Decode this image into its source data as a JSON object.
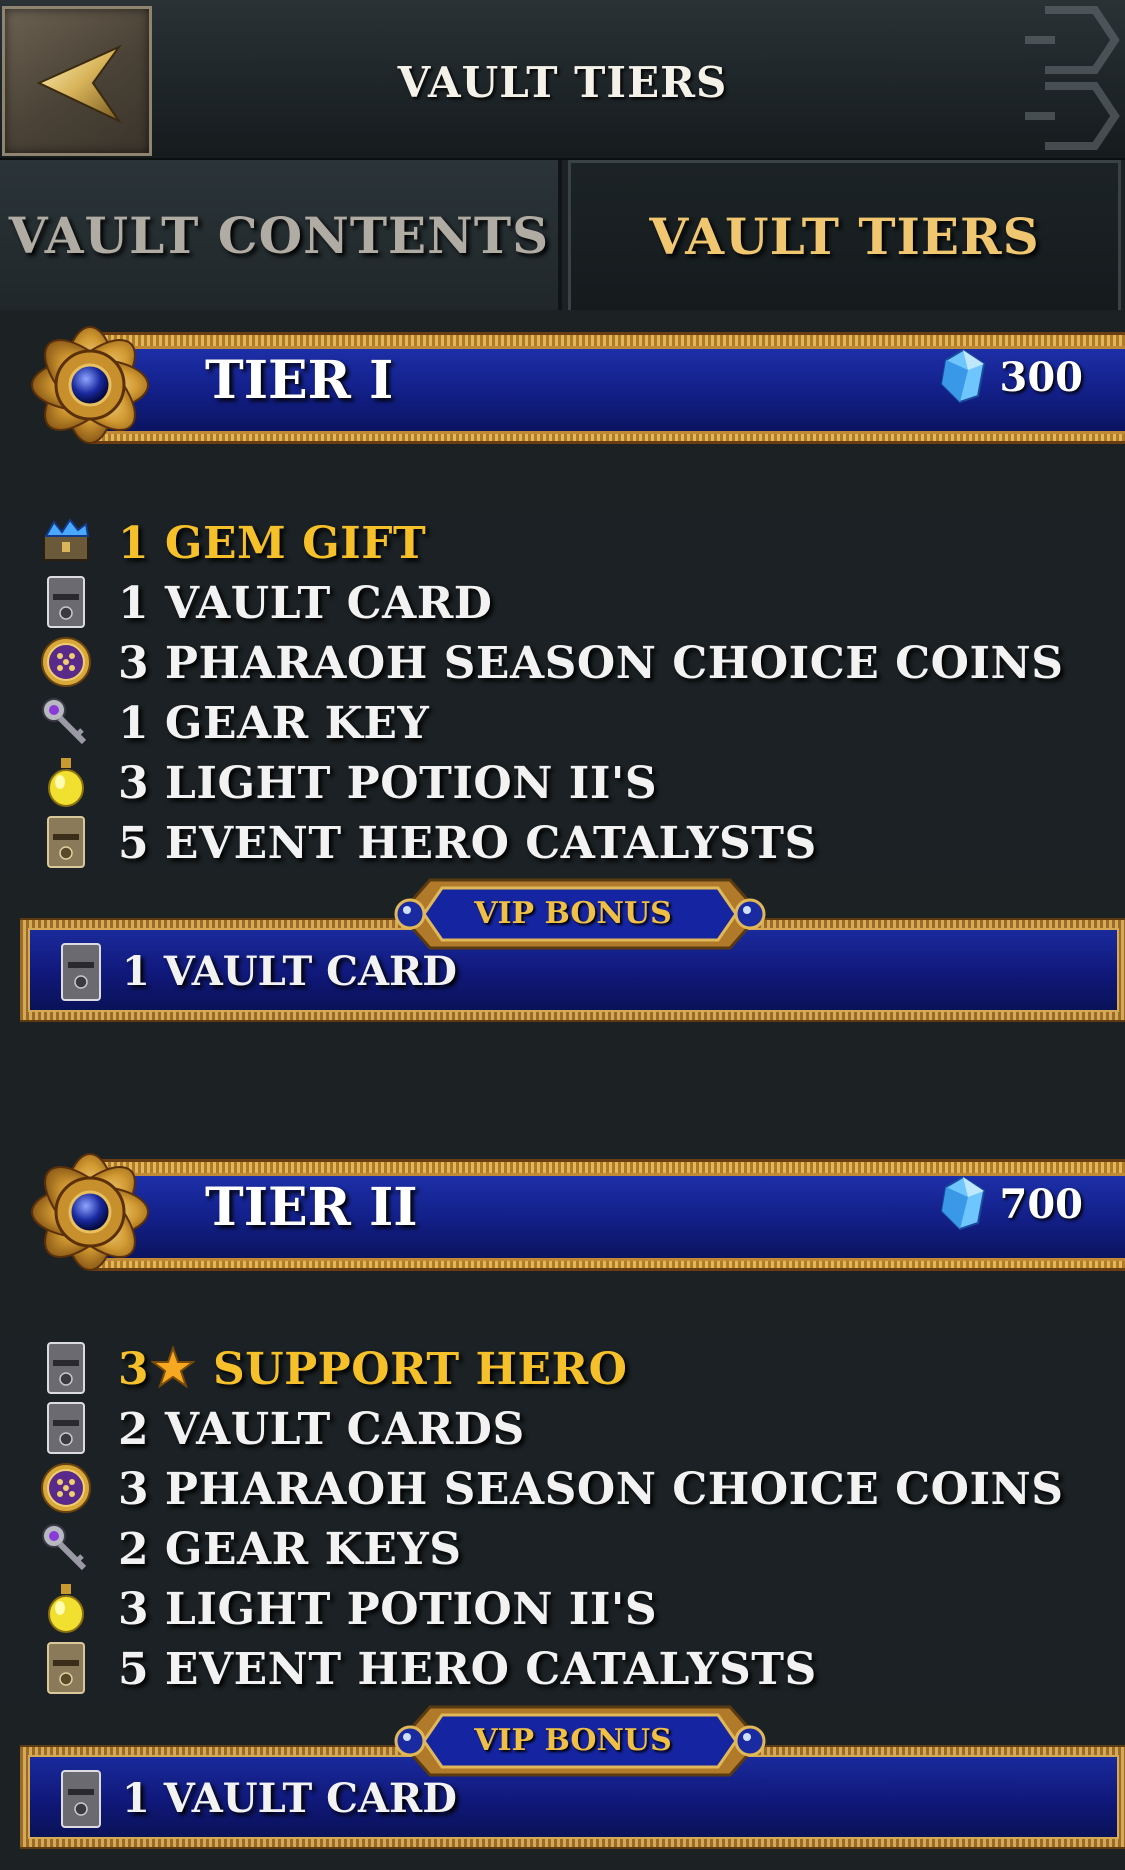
{
  "header": {
    "title": "VAULT TIERS"
  },
  "tabs": [
    {
      "label": "VAULT CONTENTS",
      "selected": false
    },
    {
      "label": "VAULT TIERS",
      "selected": true
    }
  ],
  "tiers": [
    {
      "title": "TIER I",
      "cost": "300",
      "items": [
        {
          "icon": "gem-chest-icon",
          "label": "1 GEM GIFT",
          "highlight": true
        },
        {
          "icon": "vault-card-icon",
          "label": "1 VAULT CARD"
        },
        {
          "icon": "choice-coin-icon",
          "label": "3 PHARAOH SEASON CHOICE COINS"
        },
        {
          "icon": "gear-key-icon",
          "label": "1 GEAR KEY"
        },
        {
          "icon": "light-potion-icon",
          "label": "3 LIGHT POTION II'S"
        },
        {
          "icon": "catalyst-card-icon",
          "label": "5 EVENT HERO CATALYSTS"
        }
      ],
      "vip": {
        "label": "VIP BONUS",
        "item": "1 VAULT CARD"
      }
    },
    {
      "title": "TIER II",
      "cost": "700",
      "items": [
        {
          "icon": "hero-card-icon",
          "label_prefix": "3",
          "label": "SUPPORT HERO",
          "highlight": true
        },
        {
          "icon": "vault-card-icon",
          "label": "2 VAULT CARDS"
        },
        {
          "icon": "choice-coin-icon",
          "label": "3 PHARAOH SEASON CHOICE COINS"
        },
        {
          "icon": "gear-key-icon",
          "label": "2 GEAR KEYS"
        },
        {
          "icon": "light-potion-icon",
          "label": "3 LIGHT POTION II'S"
        },
        {
          "icon": "catalyst-card-icon",
          "label": "5 EVENT HERO CATALYSTS"
        }
      ],
      "vip": {
        "label": "VIP BONUS",
        "item": "1 VAULT CARD"
      }
    }
  ],
  "colors": {
    "background": "#1c2124",
    "accent_gold": "#f5c02a",
    "tab_selected": "#f0c770",
    "banner_blue": "#13208a"
  }
}
